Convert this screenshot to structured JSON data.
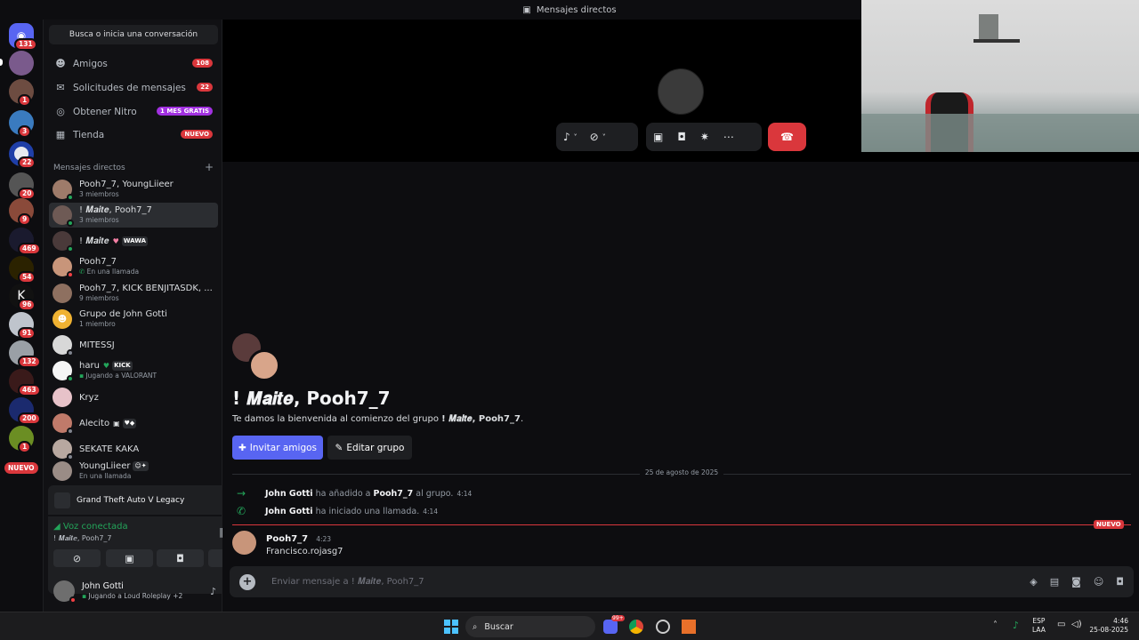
{
  "window": {
    "title": "Mensajes directos"
  },
  "rail": {
    "home_badge": "131",
    "servers": [
      {
        "badge": ""
      },
      {
        "badge": "1"
      },
      {
        "badge": "3"
      },
      {
        "badge": "22"
      },
      {
        "badge": "20"
      },
      {
        "badge": "9"
      },
      {
        "badge": "469"
      },
      {
        "badge": "54"
      },
      {
        "badge": "96"
      },
      {
        "badge": "91"
      },
      {
        "badge": "132"
      },
      {
        "badge": "463"
      },
      {
        "badge": "200"
      },
      {
        "badge": "1"
      }
    ],
    "new_label": "NUEVO"
  },
  "sidebar": {
    "search_label": "Busca o inicia una conversación",
    "nav": [
      {
        "label": "Amigos",
        "badge": "108"
      },
      {
        "label": "Solicitudes de mensajes",
        "badge": "22"
      },
      {
        "label": "Obtener Nitro",
        "badge": "1 MES GRATIS"
      },
      {
        "label": "Tienda",
        "badge": "NUEVO"
      }
    ],
    "dm_header": "Mensajes directos",
    "dm_add": "+",
    "dms": [
      {
        "name": "Pooh7_7, YoungLiieer",
        "sub": "3 miembros"
      },
      {
        "name": "! 𝑴𝒂𝒊𝒕𝒆, Pooh7_7",
        "sub": "3 miembros"
      },
      {
        "name": "! 𝑴𝒂𝒊𝒕𝒆",
        "sub": "",
        "tag": "WAWA"
      },
      {
        "name": "Pooh7_7",
        "sub": "En una llamada"
      },
      {
        "name": "Pooh7_7, KICK BENJITASDK, ...",
        "sub": "9 miembros"
      },
      {
        "name": "Grupo de John Gotti",
        "sub": "1 miembro"
      },
      {
        "name": "MITESSJ",
        "sub": ""
      },
      {
        "name": "haru",
        "sub": "Jugando a VALORANT",
        "tag": "KICK"
      },
      {
        "name": "Kryz",
        "sub": ""
      },
      {
        "name": "Alecito",
        "sub": ""
      },
      {
        "name": "SEKATE KAKA",
        "sub": ""
      },
      {
        "name": "YoungLiieer",
        "sub": "En una llamada"
      }
    ]
  },
  "game": {
    "title": "Grand Theft Auto V Legacy"
  },
  "voice": {
    "status": "Voz conectada",
    "channel": "! 𝑴𝒂𝒊𝒕𝒆, Pooh7_7"
  },
  "user": {
    "name": "John Gotti",
    "activity": "Jugando a Loud Roleplay",
    "extra": "+2"
  },
  "call": {
    "controls": [
      "mic-icon",
      "video-off-icon",
      "screen-share-icon",
      "game-icon",
      "soundboard-icon",
      "more-icon"
    ],
    "hangup": "hangup-icon"
  },
  "channel": {
    "title": "! 𝑴𝒂𝒊𝒕𝒆, Pooh7_7",
    "welcome_prefix": "Te damos la bienvenida al comienzo del grupo ",
    "welcome_name": "! 𝑴𝒂𝒊𝒕𝒆, Pooh7_7",
    "welcome_suffix": ".",
    "invite_label": "Invitar amigos",
    "edit_label": "Editar grupo",
    "date_divider": "25 de agosto de 2025",
    "system_messages": [
      {
        "actor": "John Gotti",
        "action": "ha añadido a",
        "target": "Pooh7_7",
        "tail": "al grupo.",
        "time": "4:14"
      },
      {
        "actor": "John Gotti",
        "action": "ha iniciado una llamada.",
        "target": "",
        "tail": "",
        "time": "4:14"
      }
    ],
    "new_label": "NUEVO",
    "message": {
      "author": "Pooh7_7",
      "time": "4:23",
      "text": "Francisco.rojasg7"
    },
    "composer_placeholder": "Enviar mensaje a ! 𝑴𝒂𝒊𝒕𝒆, Pooh7_7"
  },
  "taskbar": {
    "search_label": "Buscar",
    "lang_top": "ESP",
    "lang_bottom": "LAA",
    "time": "4:46",
    "date": "25-08-2025",
    "discord_badge": "99+"
  },
  "colors": {
    "accent": "#5865f2",
    "danger": "#da373c",
    "online": "#23a55a",
    "nitro": "#a231e1"
  }
}
